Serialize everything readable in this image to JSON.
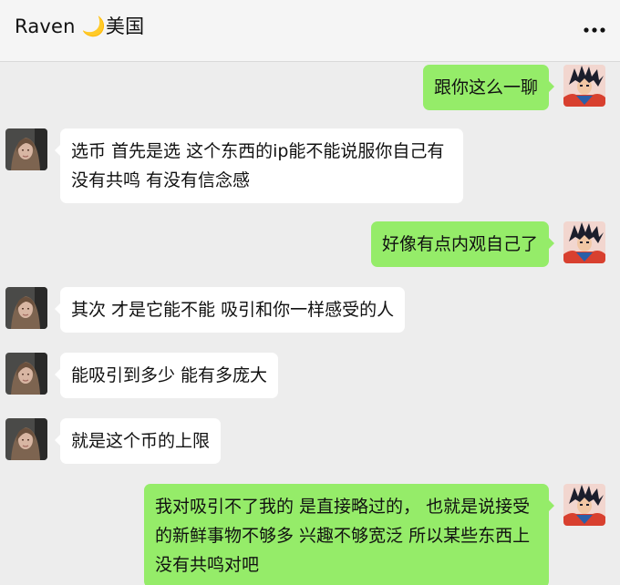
{
  "header": {
    "title": "Raven 🌙美国",
    "more_icon": "more-dots-icon"
  },
  "avatars": {
    "self": "goku-avatar-icon",
    "contact": "woman-portrait-avatar"
  },
  "colors": {
    "sent_bubble": "#95ec69",
    "received_bubble": "#ffffff",
    "chat_background": "#ededed"
  },
  "messages": [
    {
      "side": "right",
      "text": "跟你这么一聊"
    },
    {
      "side": "left",
      "text": "选币 首先是选 这个东西的ip能不能说服你自己有没有共鸣 有没有信念感"
    },
    {
      "side": "right",
      "text": "好像有点内观自己了"
    },
    {
      "side": "left",
      "text": "其次 才是它能不能 吸引和你一样感受的人"
    },
    {
      "side": "left",
      "text": "能吸引到多少  能有多庞大"
    },
    {
      "side": "left",
      "text": "就是这个币的上限"
    },
    {
      "side": "right",
      "text": "我对吸引不了我的 是直接略过的，  也就是说接受的新鲜事物不够多 兴趣不够宽泛  所以某些东西上没有共鸣对吧"
    }
  ]
}
